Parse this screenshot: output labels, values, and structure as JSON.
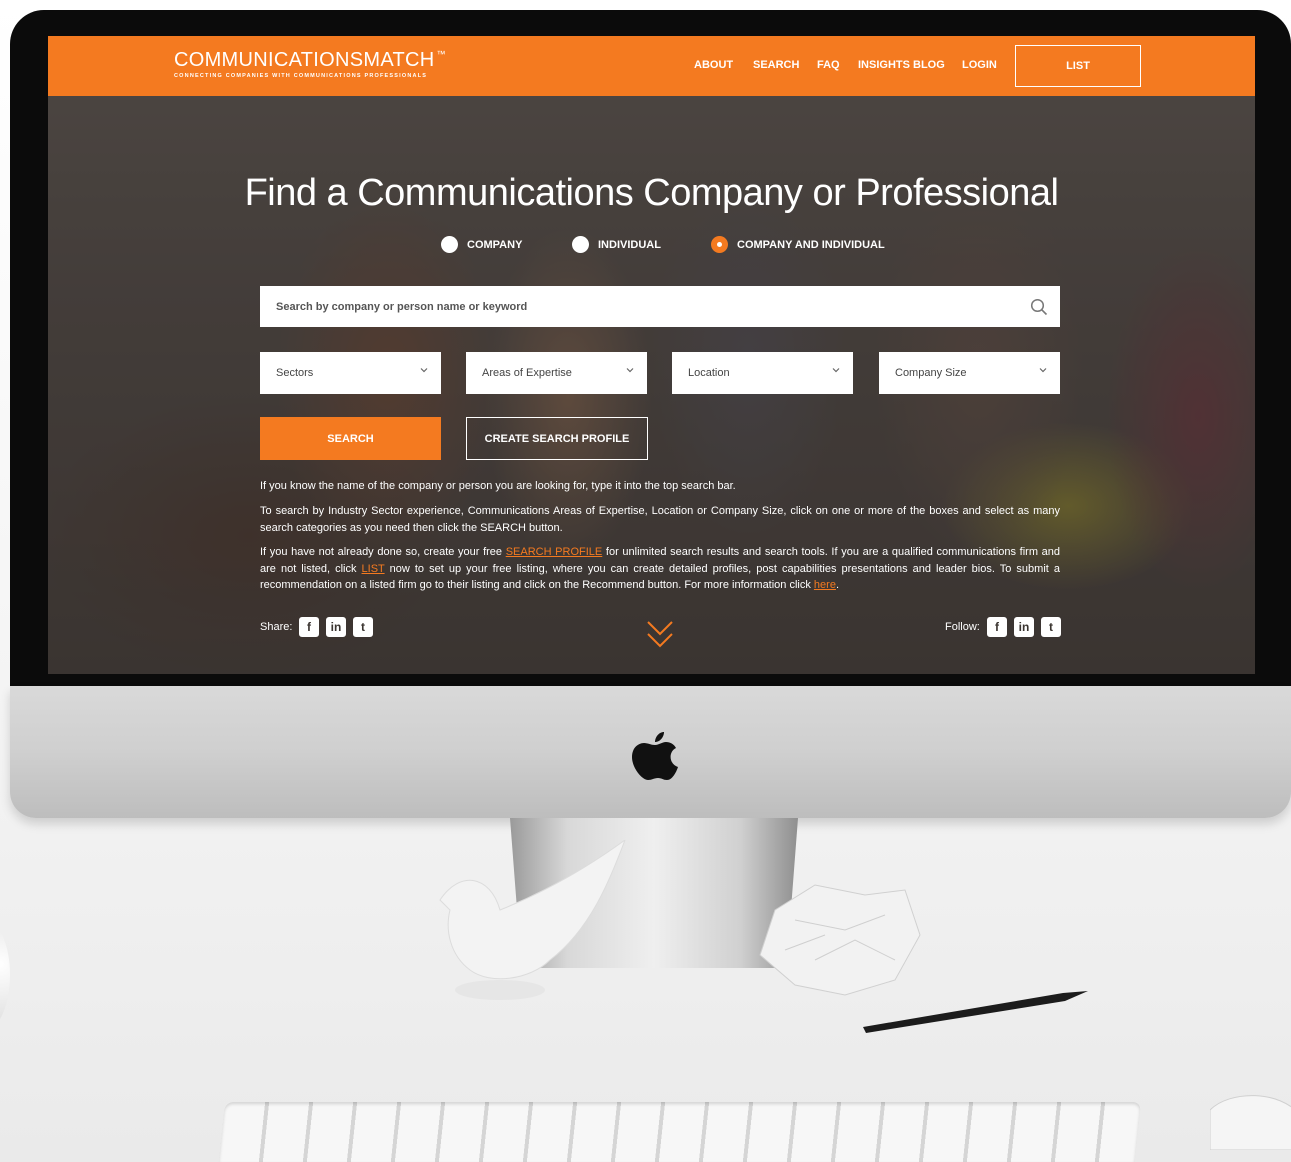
{
  "site": {
    "brand_name": "COMMUNICATIONSMATCH",
    "brand_tm": "™",
    "brand_tagline": "CONNECTING COMPANIES WITH COMMUNICATIONS PROFESSIONALS",
    "accent_color": "#f47a20"
  },
  "nav": {
    "items": [
      {
        "label": "ABOUT"
      },
      {
        "label": "SEARCH"
      },
      {
        "label": "FAQ"
      },
      {
        "label": "INSIGHTS BLOG"
      },
      {
        "label": "LOGIN"
      }
    ],
    "list_button": "LIST"
  },
  "hero": {
    "title": "Find a Communications Company or Professional",
    "radio_options": [
      {
        "label": "COMPANY",
        "selected": false
      },
      {
        "label": "INDIVIDUAL",
        "selected": false
      },
      {
        "label": "COMPANY AND INDIVIDUAL",
        "selected": true
      }
    ]
  },
  "search": {
    "placeholder": "Search by company or person name or keyword",
    "value": "",
    "icon": "search-icon"
  },
  "filters": [
    {
      "label": "Sectors"
    },
    {
      "label": "Areas of Expertise"
    },
    {
      "label": "Location"
    },
    {
      "label": "Company Size"
    }
  ],
  "buttons": {
    "search": "SEARCH",
    "create_profile": "CREATE SEARCH PROFILE"
  },
  "help": {
    "p1": "If you know the name of the company or person you are looking for, type it into the top search bar.",
    "p2": "To search by Industry Sector experience, Communications Areas of Expertise, Location or Company Size, click on one or more of the boxes and select as many search categories as you need then click the SEARCH button.",
    "p3_a": "If you have not already done so, create your free ",
    "p3_link1": "SEARCH PROFILE",
    "p3_b": " for unlimited search results and search tools. If you are a qualified communications firm and are not listed, click ",
    "p3_link2": "LIST",
    "p3_c": " now to set up your free listing, where you can create detailed profiles, post capabilities presentations and leader bios. To submit a recommendation on a listed firm go to their listing and click on the Recommend button. For more information click ",
    "p3_link3": "here",
    "p3_d": "."
  },
  "social": {
    "share_label": "Share:",
    "follow_label": "Follow:",
    "icons": [
      "facebook-icon",
      "linkedin-icon",
      "twitter-icon"
    ],
    "facebook_glyph": "f",
    "linkedin_glyph": "in",
    "twitter_glyph": "t"
  }
}
